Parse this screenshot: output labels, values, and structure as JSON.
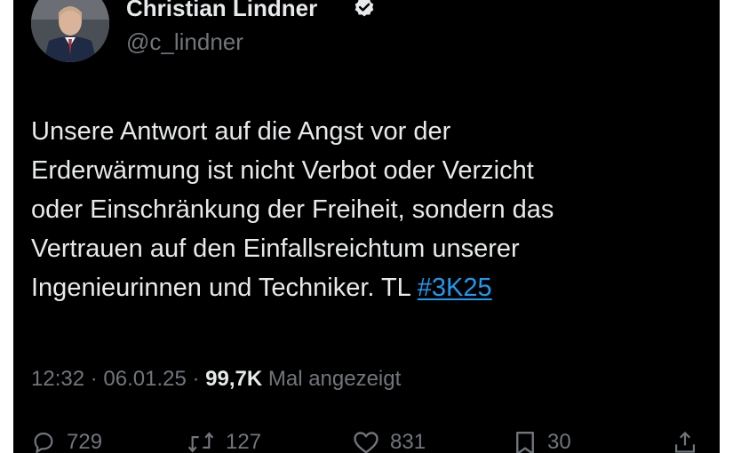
{
  "tweet": {
    "display_name": "Christian Lindner",
    "handle": "@c_lindner",
    "verified": true,
    "text_lines": [
      "Unsere Antwort auf die Angst vor der",
      "Erderwärmung ist nicht Verbot oder Verzicht",
      "oder Einschränkung der Freiheit, sondern das",
      "Vertrauen auf den Einfallsreichtum unserer",
      "Ingenieurinnen und Techniker. TL "
    ],
    "hashtag": "#3K25",
    "time": "12:32",
    "separator": " · ",
    "date": "06.01.25",
    "views": "99,7K",
    "views_label": " Mal angezeigt"
  },
  "actions": {
    "replies": "729",
    "reposts": "127",
    "likes": "831",
    "bookmarks": "30"
  },
  "icons": {
    "verified": "verified-badge-icon",
    "reply": "reply-icon",
    "repost": "repost-icon",
    "like": "heart-icon",
    "bookmark": "bookmark-icon",
    "share": "share-icon"
  },
  "colors": {
    "background": "#000000",
    "text": "#e7e9ea",
    "secondary": "#71767b",
    "link": "#1d9bf0"
  }
}
